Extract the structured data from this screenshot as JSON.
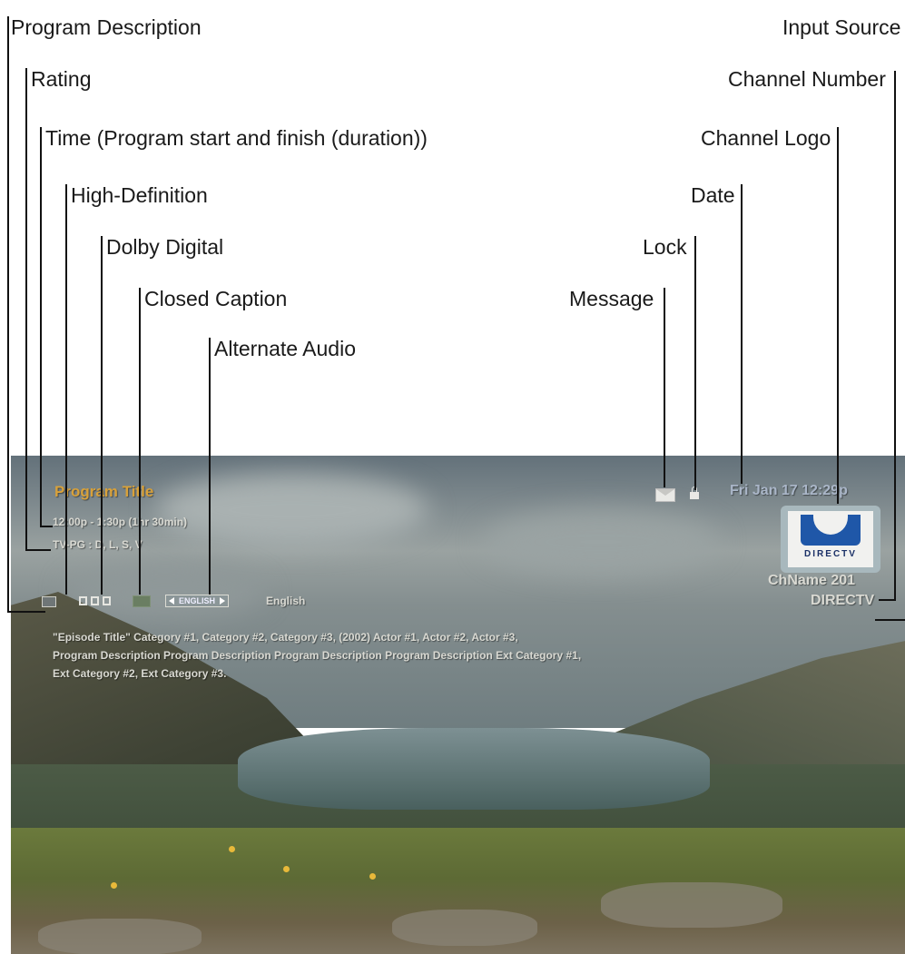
{
  "callouts": {
    "program_description": "Program Description",
    "rating": "Rating",
    "time": "Time (Program start and finish (duration))",
    "high_definition": "High-Definition",
    "dolby_digital": "Dolby Digital",
    "closed_caption": "Closed Caption",
    "alternate_audio": "Alternate Audio",
    "input_source": "Input Source",
    "channel_number": "Channel Number",
    "channel_logo": "Channel Logo",
    "date": "Date",
    "lock": "Lock",
    "message": "Message"
  },
  "osd": {
    "program_title": "Program Title",
    "time": "12:00p - 1:30p (1hr 30min)",
    "rating": "TV-PG : D, L, S, V",
    "alternate_audio_badge": "ENGLISH",
    "audio_language": "English",
    "date": "Fri Jan 17 12:29p",
    "channel_logo_text": "DIRECTV",
    "channel_name": "ChName 201",
    "input_source": "DIRECTV",
    "description_line1": "\"Episode Title\" Category #1, Category #2, Category #3, (2002) Actor #1, Actor #2, Actor #3,",
    "description_line2": "Program Description Program Description Program Description Program Description Ext Category #1,",
    "description_line3": "Ext Category #2, Ext Category #3."
  },
  "icons": {
    "message": "envelope-icon",
    "lock": "padlock-icon",
    "high_definition": "hd-icon",
    "dolby_digital": "dolby-icon",
    "closed_caption": "cc-icon"
  },
  "colors": {
    "title": "#d8a13a",
    "osd_text": "#d9d9d2",
    "logo_blue": "#1f57a8"
  }
}
